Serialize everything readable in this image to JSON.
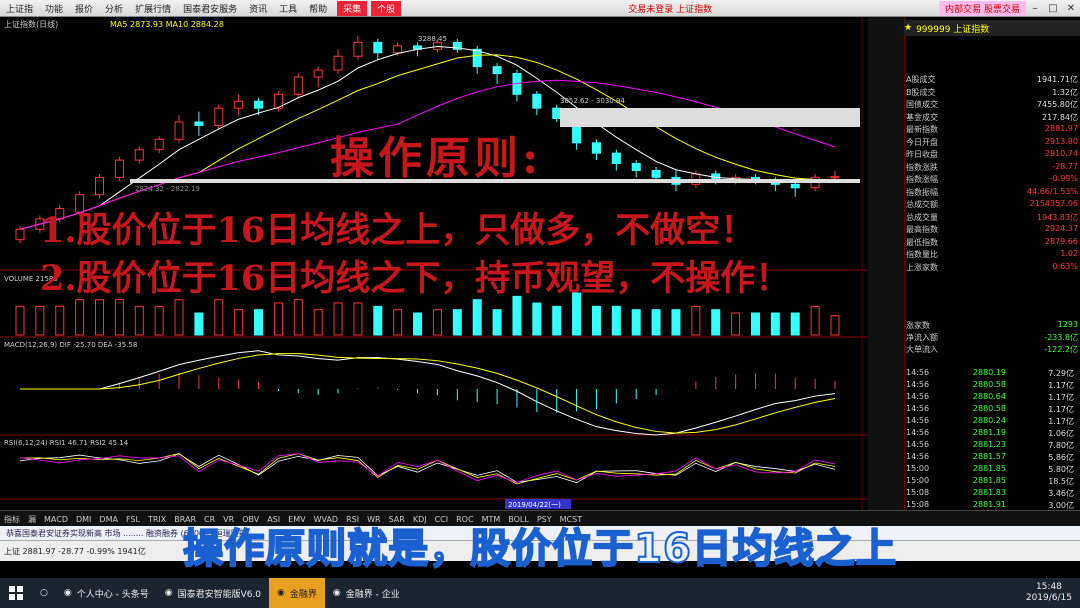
{
  "menu": {
    "items": [
      "上证指",
      "功能",
      "报价",
      "分析",
      "扩展行情",
      "国泰君安服务",
      "资讯",
      "工具",
      "帮助"
    ],
    "tab_left": "采集",
    "tab_right": "个股",
    "center_title": "交易未登录  上证指数",
    "right_label": "内部交易 股票交易"
  },
  "chart": {
    "index_label": "上证指数(日线)",
    "ma_label": "MA5  2873.93  MA10  2884.28",
    "high_label": "3288.45",
    "band_label": "3052.62 - 3030.94",
    "low_label": "2824.32 - 2822.19",
    "vol_label": "VOLUME 21580",
    "macd_label": "MACD(12,26,9)  DIF -25.70  DEA -35.58",
    "rsi_label": "RSI(6,12,24)  RSI1 46.71  RSI2 45.14",
    "date_tag": "2019/04/22(一)"
  },
  "overlay": {
    "title": "操作原则:",
    "rule1": "1.股价位于16日均线之上，只做多，不做空！",
    "rule2": "2.股价位于16日均线之下，持币观望，不操作！"
  },
  "subtitle": "操作原则就是，股价位于16日均线之上",
  "right_panel": {
    "code": "999999 上证指数",
    "rows": [
      {
        "label": "A股成交",
        "value": "1941.71亿"
      },
      {
        "label": "B股成交",
        "value": "1.32亿"
      },
      {
        "label": "国债成交",
        "value": "7455.80亿"
      },
      {
        "label": "基金成交",
        "value": "217.84亿"
      },
      {
        "label": "最新指数",
        "value": "2881.97"
      },
      {
        "label": "今日开盘",
        "value": "2913.80"
      },
      {
        "label": "昨日收盘",
        "value": "2910.74"
      },
      {
        "label": "指数涨跌",
        "value": "-28.77"
      },
      {
        "label": "指数涨幅",
        "value": "-0.99%"
      },
      {
        "label": "指数振幅",
        "value": "44.66/1.53%"
      },
      {
        "label": "总成交额",
        "value": "2154357.06"
      },
      {
        "label": "总成交量",
        "value": "1943.83亿"
      },
      {
        "label": "最高指数",
        "value": "2924.37"
      },
      {
        "label": "最低指数",
        "value": "2879.66"
      },
      {
        "label": "指数量比",
        "value": "1.02"
      },
      {
        "label": "上涨家数",
        "value": "0.63%"
      }
    ],
    "flow": [
      {
        "label": "涨家数",
        "value": "1293"
      },
      {
        "label": "净流入额",
        "value": "-233.8亿"
      },
      {
        "label": "大单流入",
        "value": "-122.2亿"
      }
    ],
    "ticks": [
      {
        "time": "14:56",
        "price": "2880.19",
        "vol": "7.29亿"
      },
      {
        "time": "14:56",
        "price": "2880.58",
        "vol": "1.17亿"
      },
      {
        "time": "14:56",
        "price": "2880.64",
        "vol": "1.17亿"
      },
      {
        "time": "14:56",
        "price": "2880.58",
        "vol": "1.17亿"
      },
      {
        "time": "14:56",
        "price": "2880.24",
        "vol": "1.17亿"
      },
      {
        "time": "14:56",
        "price": "2881.19",
        "vol": "1.06亿"
      },
      {
        "time": "14:56",
        "price": "2881.23",
        "vol": "7.80亿"
      },
      {
        "time": "14:56",
        "price": "2881.57",
        "vol": "5.86亿"
      },
      {
        "time": "15:00",
        "price": "2881.85",
        "vol": "5.80亿"
      },
      {
        "time": "15:00",
        "price": "2881.85",
        "vol": "18.5亿"
      },
      {
        "time": "15:08",
        "price": "2881.83",
        "vol": "3.46亿"
      },
      {
        "time": "15:08",
        "price": "2881.91",
        "vol": "3.00亿"
      }
    ]
  },
  "bottom_tabs": [
    "指标",
    "漏",
    "MACD",
    "DMI",
    "DMA",
    "FSL",
    "TRIX",
    "BRAR",
    "CR",
    "VR",
    "OBV",
    "ASI",
    "EMV",
    "WVAD",
    "RSI",
    "WR",
    "SAR",
    "KDJ",
    "CCI",
    "ROC",
    "MTM",
    "BOLL",
    "PSY",
    "MCST"
  ],
  "ticker": "恭喜国泰君安证券实现新高  市场  ........  融资融券  (60009)  恒瑞医药",
  "status": "上证 2881.97  -28.77  -0.99%  1941亿",
  "taskbar": {
    "items": [
      "个人中心 - 头条号",
      "国泰君安智能版V6.0",
      "金融界",
      "金融界 - 企业"
    ],
    "time": "15:48",
    "date": "2019/6/15"
  },
  "colors": {
    "up": "#ff3333",
    "down": "#33ffff",
    "red_text": "#c8161d"
  },
  "chart_data": {
    "type": "candlestick",
    "candles": [
      [
        2700,
        2730,
        2690,
        2740
      ],
      [
        2730,
        2760,
        2720,
        2770
      ],
      [
        2760,
        2790,
        2750,
        2800
      ],
      [
        2780,
        2830,
        2770,
        2840
      ],
      [
        2830,
        2880,
        2820,
        2890
      ],
      [
        2880,
        2930,
        2870,
        2940
      ],
      [
        2930,
        2960,
        2920,
        2970
      ],
      [
        2960,
        2990,
        2950,
        3000
      ],
      [
        2990,
        3040,
        2980,
        3060
      ],
      [
        3040,
        3030,
        3000,
        3070
      ],
      [
        3030,
        3080,
        3020,
        3090
      ],
      [
        3080,
        3100,
        3060,
        3120
      ],
      [
        3100,
        3080,
        3060,
        3110
      ],
      [
        3080,
        3120,
        3070,
        3130
      ],
      [
        3120,
        3170,
        3110,
        3180
      ],
      [
        3170,
        3190,
        3140,
        3200
      ],
      [
        3190,
        3230,
        3180,
        3250
      ],
      [
        3230,
        3270,
        3220,
        3288
      ],
      [
        3270,
        3240,
        3220,
        3280
      ],
      [
        3240,
        3260,
        3230,
        3270
      ],
      [
        3260,
        3250,
        3230,
        3270
      ],
      [
        3250,
        3270,
        3240,
        3280
      ],
      [
        3270,
        3250,
        3240,
        3280
      ],
      [
        3250,
        3200,
        3180,
        3260
      ],
      [
        3200,
        3180,
        3150,
        3210
      ],
      [
        3180,
        3120,
        3100,
        3190
      ],
      [
        3120,
        3080,
        3060,
        3130
      ],
      [
        3080,
        3050,
        3040,
        3090
      ],
      [
        3050,
        2980,
        2960,
        3052
      ],
      [
        2980,
        2950,
        2930,
        2990
      ],
      [
        2950,
        2920,
        2900,
        2960
      ],
      [
        2920,
        2900,
        2880,
        2930
      ],
      [
        2900,
        2880,
        2870,
        2910
      ],
      [
        2880,
        2860,
        2840,
        2900
      ],
      [
        2860,
        2890,
        2850,
        2900
      ],
      [
        2890,
        2870,
        2860,
        2900
      ],
      [
        2870,
        2880,
        2860,
        2890
      ],
      [
        2880,
        2870,
        2860,
        2890
      ],
      [
        2870,
        2860,
        2840,
        2880
      ],
      [
        2860,
        2850,
        2824,
        2870
      ],
      [
        2850,
        2880,
        2840,
        2890
      ],
      [
        2880,
        2882,
        2870,
        2900
      ]
    ]
  }
}
